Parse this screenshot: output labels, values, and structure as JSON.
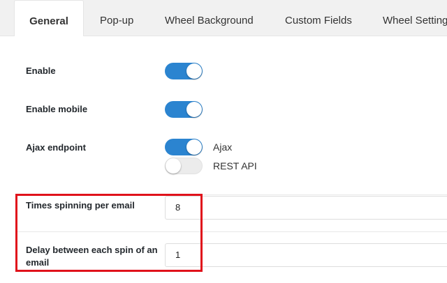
{
  "tabs": [
    {
      "label": "General"
    },
    {
      "label": "Pop-up"
    },
    {
      "label": "Wheel Background"
    },
    {
      "label": "Custom Fields"
    },
    {
      "label": "Wheel Settings"
    }
  ],
  "settings": {
    "enable": {
      "label": "Enable",
      "on": true
    },
    "enable_mobile": {
      "label": "Enable mobile",
      "on": true
    },
    "ajax_endpoint": {
      "label": "Ajax endpoint",
      "options": [
        {
          "label": "Ajax",
          "on": true
        },
        {
          "label": "REST API",
          "on": false
        }
      ]
    },
    "times_spinning": {
      "label": "Times spinning per email",
      "value": "8"
    },
    "delay_between": {
      "label": "Delay between each spin of an email",
      "value": "1"
    }
  },
  "colors": {
    "accent": "#2b84d0",
    "highlight": "#e0121b"
  }
}
